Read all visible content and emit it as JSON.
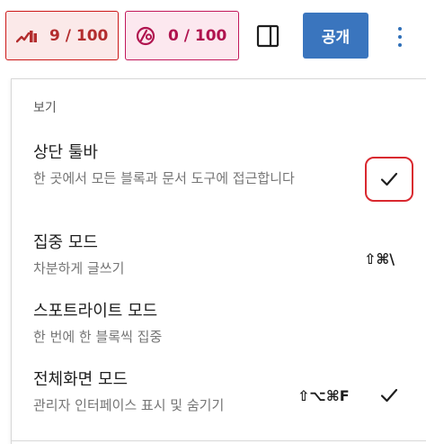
{
  "toolbar": {
    "seo_score": "9 / 100",
    "readability_score": "0 / 100",
    "publish_label": "공개",
    "accent_color": "#3a75be",
    "seo_color": "#cc1818",
    "readability_color": "#c2185b"
  },
  "menu": {
    "group_title": "보기",
    "items": [
      {
        "title": "상단 툴바",
        "description": "한 곳에서 모든 블록과 문서 도구에 접근합니다",
        "shortcut": "",
        "checked": true
      },
      {
        "title": "집중 모드",
        "description": "차분하게 글쓰기",
        "shortcut": "⇧⌘\\",
        "checked": false
      },
      {
        "title": "스포트라이트 모드",
        "description": "한 번에 한 블록씩 집중",
        "shortcut": "",
        "checked": false
      },
      {
        "title": "전체화면 모드",
        "description": "관리자 인터페이스 표시 및 숨기기",
        "shortcut": "⇧⌥⌘F",
        "checked": true
      }
    ]
  }
}
